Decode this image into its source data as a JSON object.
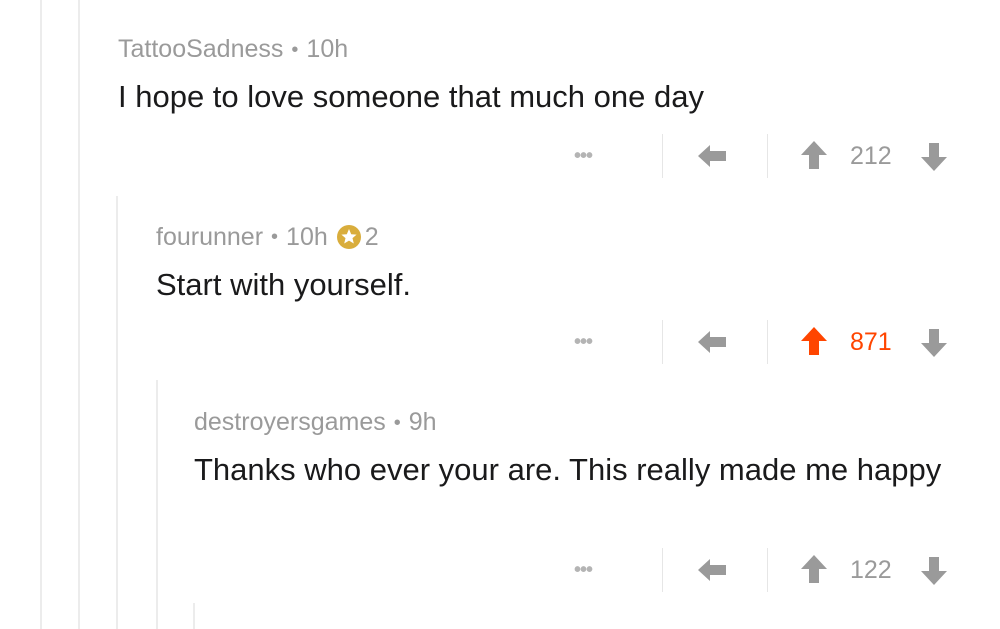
{
  "comments": [
    {
      "author": "TattooSadness",
      "separator": "•",
      "age": "10h",
      "body": "I hope to love someone that much one day",
      "more": "•••",
      "score": "212",
      "upvoted": false
    },
    {
      "author": "fourunner",
      "separator": "•",
      "age": "10h",
      "gild_count": "2",
      "body": "Start with yourself.",
      "more": "•••",
      "score": "871",
      "upvoted": true
    },
    {
      "author": "destroyersgames",
      "separator": "•",
      "age": "9h",
      "body": "Thanks who ever your are. This really made me happy",
      "more": "•••",
      "score": "122",
      "upvoted": false
    }
  ],
  "colors": {
    "upvote_active": "#ff4500",
    "icon_gray": "#9a9a9a",
    "gild": "#d9ad3c"
  },
  "icons": {
    "more": "more-options-icon",
    "reply": "reply-arrow-icon",
    "upvote": "upvote-arrow-icon",
    "downvote": "downvote-arrow-icon",
    "gild": "gold-star-icon"
  }
}
